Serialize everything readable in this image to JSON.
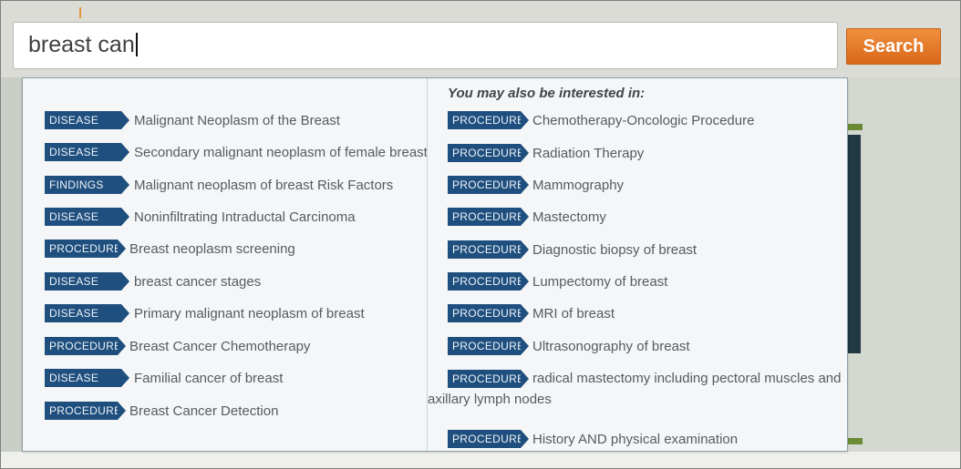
{
  "search": {
    "value": "breast can",
    "button_label": "Search"
  },
  "dropdown": {
    "left_suggestions": [
      {
        "tag": "DISEASE",
        "label": "Malignant Neoplasm of the Breast"
      },
      {
        "tag": "DISEASE",
        "label": "Secondary malignant neoplasm of female breast"
      },
      {
        "tag": "FINDINGS",
        "label": "Malignant neoplasm of breast Risk Factors"
      },
      {
        "tag": "DISEASE",
        "label": "Noninfiltrating Intraductal Carcinoma"
      },
      {
        "tag": "PROCEDURE",
        "label": "Breast neoplasm screening"
      },
      {
        "tag": "DISEASE",
        "label": "breast cancer stages"
      },
      {
        "tag": "DISEASE",
        "label": "Primary malignant neoplasm of breast"
      },
      {
        "tag": "PROCEDURE",
        "label": "Breast Cancer Chemotherapy"
      },
      {
        "tag": "DISEASE",
        "label": "Familial cancer of breast"
      },
      {
        "tag": "PROCEDURE",
        "label": "Breast Cancer Detection"
      }
    ],
    "also_interested_heading": "You may also be interested in:",
    "right_suggestions": [
      {
        "tag": "PROCEDURE",
        "label": "Chemotherapy-Oncologic Procedure"
      },
      {
        "tag": "PROCEDURE",
        "label": "Radiation Therapy"
      },
      {
        "tag": "PROCEDURE",
        "label": "Mammography"
      },
      {
        "tag": "PROCEDURE",
        "label": "Mastectomy"
      },
      {
        "tag": "PROCEDURE",
        "label": "Diagnostic biopsy of breast"
      },
      {
        "tag": "PROCEDURE",
        "label": "Lumpectomy of breast"
      },
      {
        "tag": "PROCEDURE",
        "label": "MRI of breast"
      },
      {
        "tag": "PROCEDURE",
        "label": "Ultrasonography of breast"
      },
      {
        "tag": "PROCEDURE",
        "label": "radical mastectomy including pectoral muscles and",
        "label_continued": "axillary lymph nodes"
      },
      {
        "tag": "PROCEDURE",
        "label": "History AND physical examination"
      }
    ]
  },
  "colors": {
    "tag_background": "#1f4f7e",
    "search_button": "#e2762a",
    "accent_green": "#6b8a35",
    "dark_panel": "#213943"
  }
}
